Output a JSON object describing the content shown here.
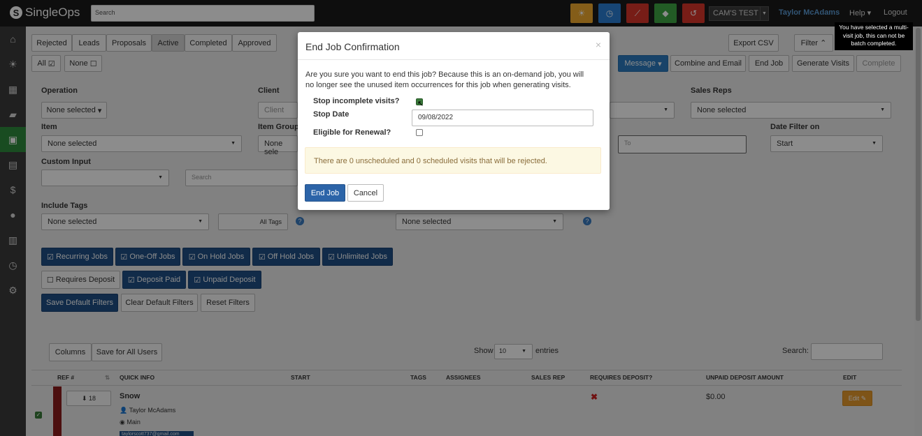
{
  "app": {
    "name": "SingleOps"
  },
  "topbar": {
    "search_placeholder": "Search",
    "account": "CAM'S TEST",
    "user": "Taylor McAdams",
    "help": "Help",
    "logout": "Logout",
    "tooltip": "You have selected a multi-visit job, this can not be batch completed."
  },
  "tabs": [
    {
      "label": "Rejected"
    },
    {
      "label": "Leads"
    },
    {
      "label": "Proposals"
    },
    {
      "label": "Active"
    },
    {
      "label": "Completed"
    },
    {
      "label": "Approved"
    }
  ],
  "select_all": "All",
  "select_none": "None",
  "toolbar": {
    "export_csv": "Export CSV",
    "filter": "Filter",
    "message": "Message",
    "combine_email": "Combine and Email",
    "end_job": "End Job",
    "generate_visits": "Generate Visits",
    "complete": "Complete"
  },
  "filters": {
    "operation_label": "Operation",
    "operation_value": "None selected",
    "client_label": "Client",
    "client_placeholder": "Client",
    "sales_reps_label": "Sales Reps",
    "sales_reps_value": "None selected",
    "item_label": "Item",
    "item_value": "None selected",
    "item_group_label": "Item Group",
    "item_group_value": "None sele",
    "date_to_placeholder": "To",
    "date_filter_label": "Date Filter on",
    "date_filter_value": "Start",
    "custom_input_label": "Custom Input",
    "custom_search_placeholder": "Search",
    "include_tags_label": "Include Tags",
    "include_tags_value": "None selected",
    "all_tags": "All Tags",
    "exclude_value": "None selected"
  },
  "filter_buttons": [
    "Recurring Jobs",
    "One-Off Jobs",
    "On Hold Jobs",
    "Off Hold Jobs",
    "Unlimited Jobs"
  ],
  "deposit_buttons": [
    "Requires Deposit",
    "Deposit Paid",
    "Unpaid Deposit"
  ],
  "default_buttons": [
    "Save Default Filters",
    "Clear Default Filters",
    "Reset Filters"
  ],
  "table": {
    "columns_btn": "Columns",
    "save_all_users": "Save for All Users",
    "show_label": "Show",
    "entries_value": "10",
    "entries_label": "entries",
    "search_label": "Search:",
    "headers": [
      "REF #",
      "QUICK INFO",
      "START",
      "TAGS",
      "ASSIGNEES",
      "SALES REP",
      "REQUIRES DEPOSIT?",
      "UNPAID DEPOSIT AMOUNT",
      "EDIT"
    ],
    "row": {
      "ref": "18",
      "name": "Snow",
      "contact": "Taylor McAdams",
      "location": "Main",
      "email": "taylorscott737@gmail.com",
      "amount": "$0.00",
      "edit": "Edit"
    }
  },
  "modal": {
    "title": "End Job Confirmation",
    "close": "×",
    "body": "Are you sure you want to end this job? Because this is an on-demand job, you will no longer see the unused item occurrences for this job when generating visits.",
    "stop_incomplete_label": "Stop incomplete visits?",
    "stop_incomplete_checked": true,
    "stop_date_label": "Stop Date",
    "stop_date_value": "09/08/2022",
    "eligible_label": "Eligible for Renewal?",
    "eligible_checked": false,
    "warning": "There are 0 unscheduled and 0 scheduled visits that will be rejected.",
    "end_job_btn": "End Job",
    "cancel_btn": "Cancel"
  },
  "colors": {
    "topbar": "#1a1a1a",
    "sidebar": "#3b3b3b",
    "active_nav": "#2f8a3c",
    "primary": "#1f4f85",
    "modal_primary": "#2c64a8",
    "warn_bg": "#fcf8e3"
  }
}
